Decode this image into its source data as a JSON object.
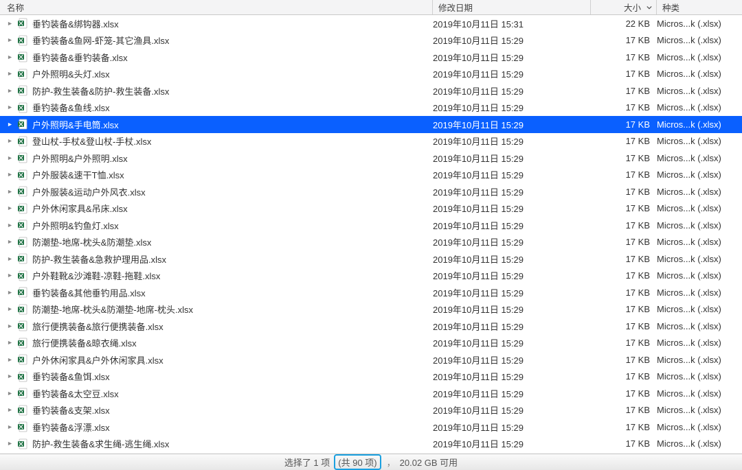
{
  "columns": {
    "name": "名称",
    "date": "修改日期",
    "size": "大小",
    "kind": "种类"
  },
  "kind_label": "Micros...k (.xlsx)",
  "selected_index": 6,
  "files": [
    {
      "name": "垂钓装备&绑钩器.xlsx",
      "date": "2019年10月11日 15:31",
      "size": "22 KB"
    },
    {
      "name": "垂钓装备&鱼网-虾笼-其它渔具.xlsx",
      "date": "2019年10月11日 15:29",
      "size": "17 KB"
    },
    {
      "name": "垂钓装备&垂钓装备.xlsx",
      "date": "2019年10月11日 15:29",
      "size": "17 KB"
    },
    {
      "name": "户外照明&头灯.xlsx",
      "date": "2019年10月11日 15:29",
      "size": "17 KB"
    },
    {
      "name": "防护-救生装备&防护-救生装备.xlsx",
      "date": "2019年10月11日 15:29",
      "size": "17 KB"
    },
    {
      "name": "垂钓装备&鱼线.xlsx",
      "date": "2019年10月11日 15:29",
      "size": "17 KB"
    },
    {
      "name": "户外照明&手电筒.xlsx",
      "date": "2019年10月11日 15:29",
      "size": "17 KB"
    },
    {
      "name": "登山杖-手杖&登山杖-手杖.xlsx",
      "date": "2019年10月11日 15:29",
      "size": "17 KB"
    },
    {
      "name": "户外照明&户外照明.xlsx",
      "date": "2019年10月11日 15:29",
      "size": "17 KB"
    },
    {
      "name": "户外服装&速干T恤.xlsx",
      "date": "2019年10月11日 15:29",
      "size": "17 KB"
    },
    {
      "name": "户外服装&运动户外风衣.xlsx",
      "date": "2019年10月11日 15:29",
      "size": "17 KB"
    },
    {
      "name": "户外休闲家具&吊床.xlsx",
      "date": "2019年10月11日 15:29",
      "size": "17 KB"
    },
    {
      "name": "户外照明&钓鱼灯.xlsx",
      "date": "2019年10月11日 15:29",
      "size": "17 KB"
    },
    {
      "name": "防潮垫-地席-枕头&防潮垫.xlsx",
      "date": "2019年10月11日 15:29",
      "size": "17 KB"
    },
    {
      "name": "防护-救生装备&急救护理用品.xlsx",
      "date": "2019年10月11日 15:29",
      "size": "17 KB"
    },
    {
      "name": "户外鞋靴&沙滩鞋-凉鞋-拖鞋.xlsx",
      "date": "2019年10月11日 15:29",
      "size": "17 KB"
    },
    {
      "name": "垂钓装备&其他垂钓用品.xlsx",
      "date": "2019年10月11日 15:29",
      "size": "17 KB"
    },
    {
      "name": "防潮垫-地席-枕头&防潮垫-地席-枕头.xlsx",
      "date": "2019年10月11日 15:29",
      "size": "17 KB"
    },
    {
      "name": "旅行便携装备&旅行便携装备.xlsx",
      "date": "2019年10月11日 15:29",
      "size": "17 KB"
    },
    {
      "name": "旅行便携装备&晾衣绳.xlsx",
      "date": "2019年10月11日 15:29",
      "size": "17 KB"
    },
    {
      "name": "户外休闲家具&户外休闲家具.xlsx",
      "date": "2019年10月11日 15:29",
      "size": "17 KB"
    },
    {
      "name": "垂钓装备&鱼饵.xlsx",
      "date": "2019年10月11日 15:29",
      "size": "17 KB"
    },
    {
      "name": "垂钓装备&太空豆.xlsx",
      "date": "2019年10月11日 15:29",
      "size": "17 KB"
    },
    {
      "name": "垂钓装备&支架.xlsx",
      "date": "2019年10月11日 15:29",
      "size": "17 KB"
    },
    {
      "name": "垂钓装备&浮漂.xlsx",
      "date": "2019年10月11日 15:29",
      "size": "17 KB"
    },
    {
      "name": "防护-救生装备&求生绳-逃生绳.xlsx",
      "date": "2019年10月11日 15:29",
      "size": "17 KB"
    }
  ],
  "status": {
    "selected": "选择了 1 项",
    "total": "(共 90 项)",
    "comma": "，",
    "free": "20.02 GB 可用"
  }
}
